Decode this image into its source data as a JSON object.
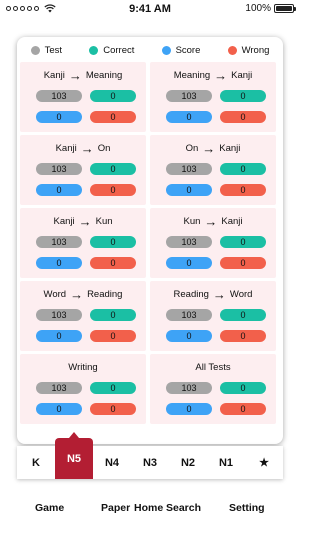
{
  "status_bar": {
    "time": "9:41 AM",
    "battery": "100%"
  },
  "legend": [
    {
      "label": "Test",
      "color": "#a5a5a5"
    },
    {
      "label": "Correct",
      "color": "#1bbfa4"
    },
    {
      "label": "Score",
      "color": "#3ea3f6"
    },
    {
      "label": "Wrong",
      "color": "#f2604b"
    }
  ],
  "tests": [
    {
      "from": "Kanji",
      "to": "Meaning",
      "test": "103",
      "correct": "0",
      "score": "0",
      "wrong": "0"
    },
    {
      "from": "Meaning",
      "to": "Kanji",
      "test": "103",
      "correct": "0",
      "score": "0",
      "wrong": "0"
    },
    {
      "from": "Kanji",
      "to": "On",
      "test": "103",
      "correct": "0",
      "score": "0",
      "wrong": "0"
    },
    {
      "from": "On",
      "to": "Kanji",
      "test": "103",
      "correct": "0",
      "score": "0",
      "wrong": "0"
    },
    {
      "from": "Kanji",
      "to": "Kun",
      "test": "103",
      "correct": "0",
      "score": "0",
      "wrong": "0"
    },
    {
      "from": "Kun",
      "to": "Kanji",
      "test": "103",
      "correct": "0",
      "score": "0",
      "wrong": "0"
    },
    {
      "from": "Word",
      "to": "Reading",
      "test": "103",
      "correct": "0",
      "score": "0",
      "wrong": "0"
    },
    {
      "from": "Reading",
      "to": "Word",
      "test": "103",
      "correct": "0",
      "score": "0",
      "wrong": "0"
    },
    {
      "title": "Writing",
      "test": "103",
      "correct": "0",
      "score": "0",
      "wrong": "0"
    },
    {
      "title": "All Tests",
      "test": "103",
      "correct": "0",
      "score": "0",
      "wrong": "0"
    }
  ],
  "levels": {
    "items": [
      "K",
      "N5",
      "N4",
      "N3",
      "N2",
      "N1",
      "★"
    ],
    "active": "N5",
    "active_color": "#b31e33"
  },
  "tabs": {
    "game": "Game",
    "paper": "Paper",
    "home": "Home",
    "search": "Search",
    "setting": "Setting"
  }
}
